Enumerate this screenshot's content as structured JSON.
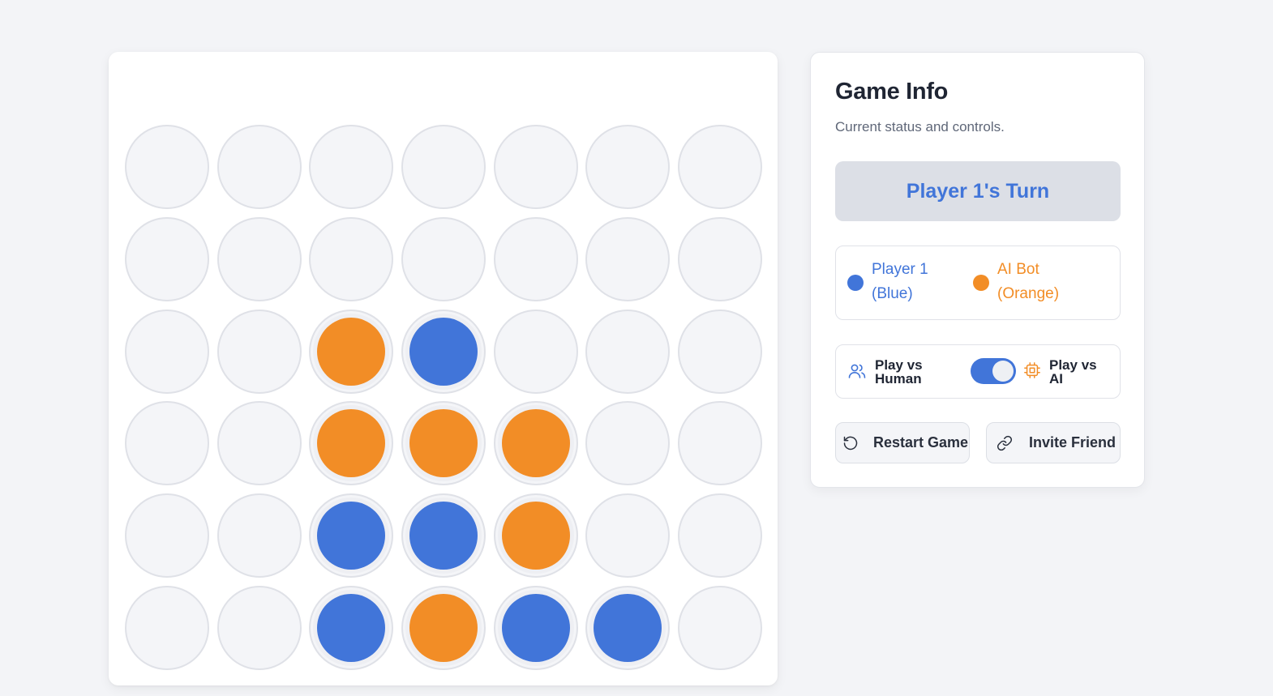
{
  "colors": {
    "player1": "#4175d9",
    "ai": "#f28d26",
    "empty": "#f4f5f8"
  },
  "board": {
    "rows": 6,
    "cols": 7,
    "cells": [
      [
        "",
        "",
        "",
        "",
        "",
        "",
        ""
      ],
      [
        "",
        "",
        "",
        "",
        "",
        "",
        ""
      ],
      [
        "",
        "",
        "O",
        "B",
        "",
        "",
        ""
      ],
      [
        "",
        "",
        "O",
        "O",
        "O",
        "",
        ""
      ],
      [
        "",
        "",
        "B",
        "B",
        "O",
        "",
        ""
      ],
      [
        "",
        "",
        "B",
        "O",
        "B",
        "B",
        ""
      ]
    ]
  },
  "info": {
    "title": "Game Info",
    "subtitle": "Current status and controls.",
    "turn": "Player 1's Turn",
    "legend": {
      "player1_line1": "Player 1",
      "player1_line2": "(Blue)",
      "ai_line1": "AI Bot",
      "ai_line2": "(Orange)"
    },
    "mode": {
      "human_label": "Play vs Human",
      "ai_label": "Play vs AI",
      "ai_enabled": true,
      "human_icon": "users-icon",
      "ai_icon": "cpu-chip-icon"
    },
    "buttons": {
      "restart": "Restart Game",
      "invite": "Invite Friend",
      "restart_icon": "rotate-ccw-icon",
      "invite_icon": "link-icon"
    }
  }
}
